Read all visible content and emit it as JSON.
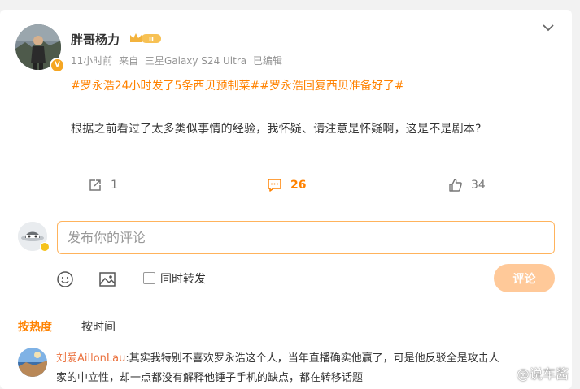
{
  "post": {
    "author": "胖哥杨力",
    "rank_badge": "II",
    "time": "11小时前",
    "source_prefix": "来自",
    "device": "三星Galaxy S24 Ultra",
    "edited": "已编辑",
    "hashtags": [
      "#罗永浩24小时发了5条西贝预制菜#",
      "#罗永浩回复西贝准备好了#"
    ],
    "text": "根据之前看过了太多类似事情的经验，我怀疑、请注意是怀疑啊，这是不是剧本?"
  },
  "actions": {
    "repost_count": "1",
    "comment_count": "26",
    "like_count": "34"
  },
  "composer": {
    "placeholder": "发布你的评论",
    "repost_label": "同时转发",
    "submit_label": "评论"
  },
  "sort": {
    "hot": "按热度",
    "time": "按时间"
  },
  "comment": {
    "user": "刘爱AillonLau",
    "line1": ":其实我特别不喜欢罗永浩这个人，当年直播确实他赢了，可是他反驳全是攻击人",
    "line2": "家的中立性，却一点都没有解释他锤子手机的缺点，都在转移话题"
  },
  "watermark": "@说车酱",
  "colors": {
    "accent": "#ff8200",
    "username": "#eb7340",
    "button_disabled": "#ffc999"
  }
}
